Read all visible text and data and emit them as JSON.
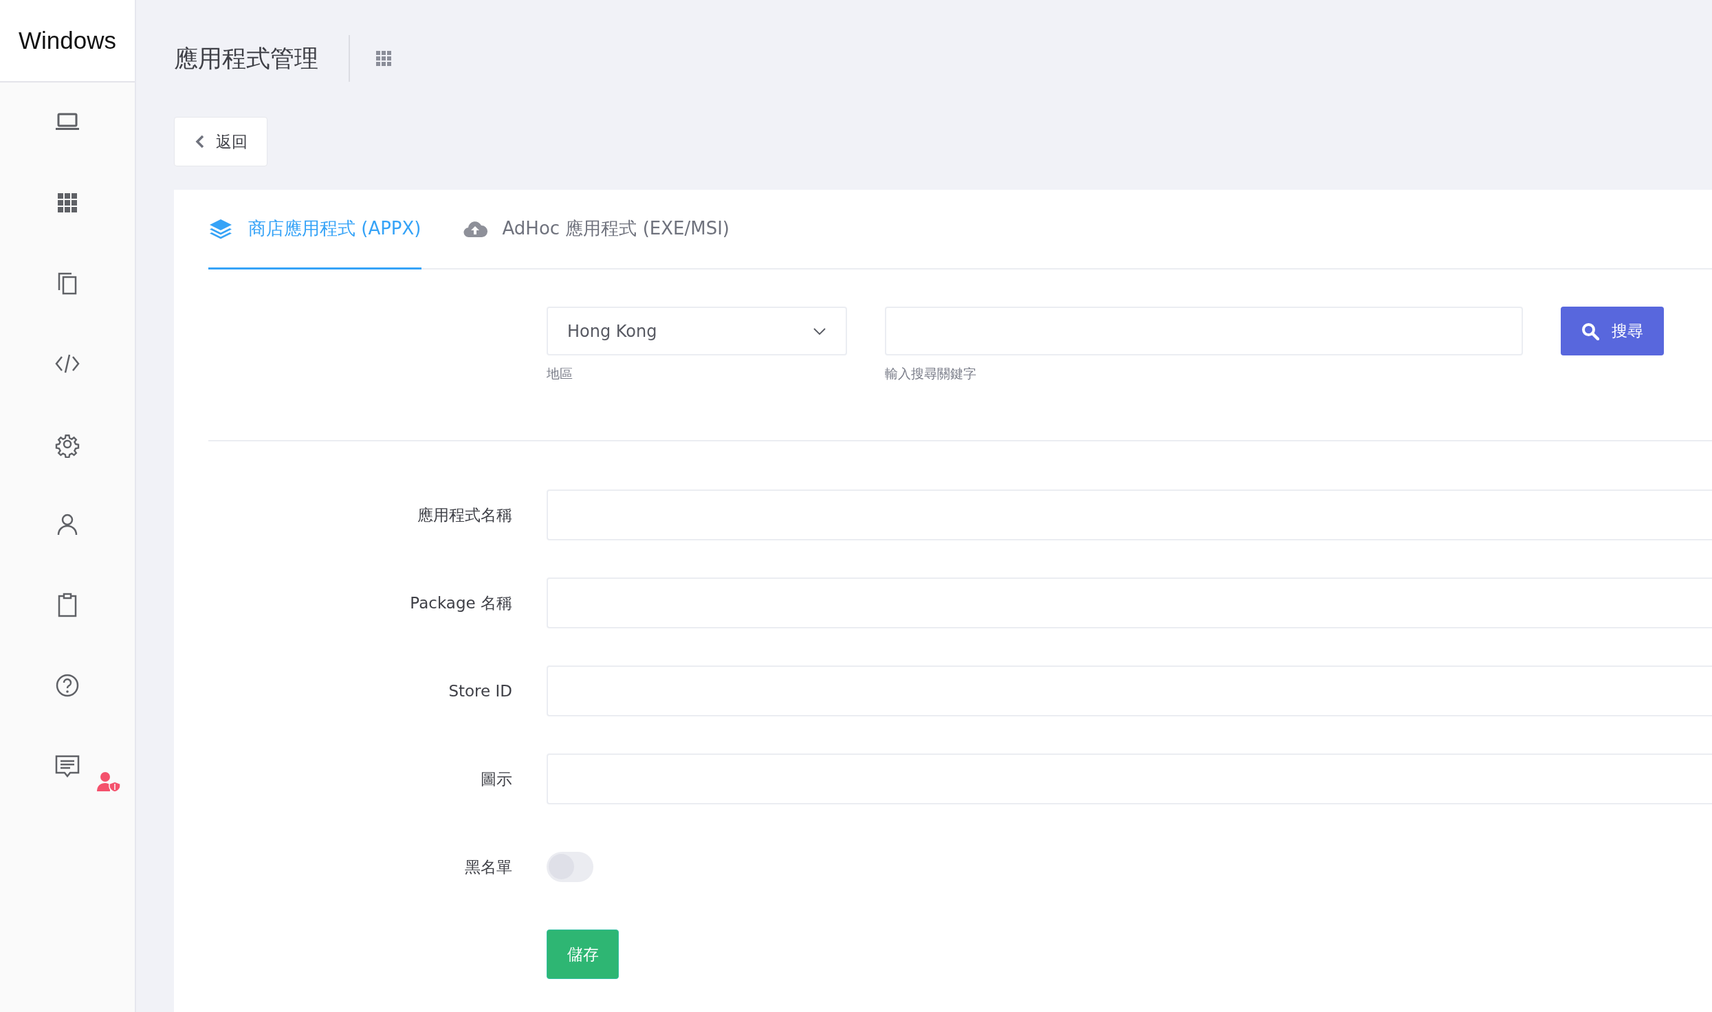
{
  "sidebar": {
    "title": "Windows"
  },
  "header": {
    "title": "應用程式管理"
  },
  "back_button": {
    "label": "返回"
  },
  "tabs": [
    {
      "label": "商店應用程式 (APPX)",
      "selected": true
    },
    {
      "label": "AdHoc 應用程式 (EXE/MSI)",
      "selected": false
    }
  ],
  "search": {
    "region": {
      "value": "Hong Kong",
      "helper": "地區"
    },
    "keyword": {
      "helper": "輸入搜尋關鍵字"
    },
    "button": "搜尋"
  },
  "form": {
    "fields": [
      {
        "kind": "text",
        "label": "應用程式名稱"
      },
      {
        "kind": "text",
        "label": "Package 名稱"
      },
      {
        "kind": "text",
        "label": "Store ID"
      },
      {
        "kind": "text",
        "label": "圖示"
      },
      {
        "kind": "toggle",
        "label": "黑名單",
        "on": false
      }
    ],
    "save_button": "儲存"
  }
}
